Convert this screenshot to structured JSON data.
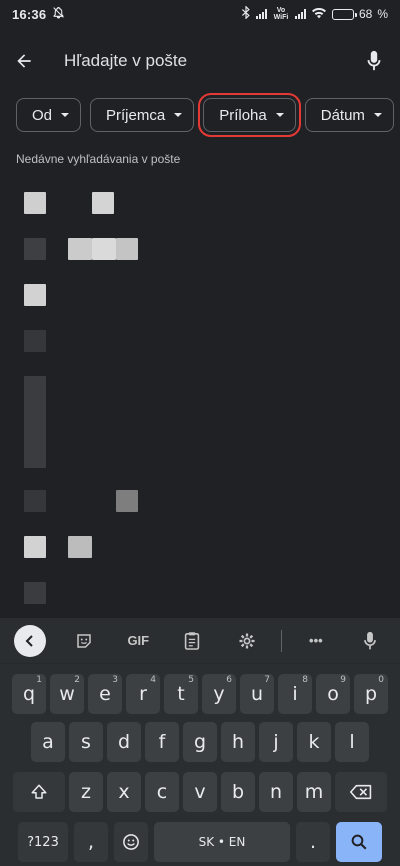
{
  "status": {
    "time": "16:36",
    "battery": "68",
    "battery_level": 0.68,
    "vowifi": "Vo WiFi",
    "icons": [
      "mute-notifications-icon",
      "bluetooth-icon",
      "signal-icon",
      "wifi-icon",
      "battery-icon"
    ]
  },
  "search": {
    "placeholder": "Hľadajte v pošte",
    "back_icon": "arrow-back-icon",
    "mic_icon": "mic-icon"
  },
  "chips": [
    "Od",
    "Príjemca",
    "Príloha",
    "Dátum"
  ],
  "recent": {
    "label": "Nedávne vyhľadávania v pošte"
  },
  "keyboard": {
    "toolbar": [
      "back-icon",
      "sticker-icon",
      "GIF",
      "clipboard-icon",
      "settings-icon",
      "more-icon",
      "mic-icon"
    ],
    "gif": "GIF",
    "more": "•••",
    "row1": [
      {
        "k": "q",
        "n": "1"
      },
      {
        "k": "w",
        "n": "2"
      },
      {
        "k": "e",
        "n": "3"
      },
      {
        "k": "r",
        "n": "4"
      },
      {
        "k": "t",
        "n": "5"
      },
      {
        "k": "y",
        "n": "6"
      },
      {
        "k": "u",
        "n": "7"
      },
      {
        "k": "i",
        "n": "8"
      },
      {
        "k": "o",
        "n": "9"
      },
      {
        "k": "p",
        "n": "0"
      }
    ],
    "row2": [
      "a",
      "s",
      "d",
      "f",
      "g",
      "h",
      "j",
      "k",
      "l"
    ],
    "row3": [
      "z",
      "x",
      "c",
      "v",
      "b",
      "n",
      "m"
    ],
    "symbols": "?123",
    "space": "SK • EN",
    "comma": ",",
    "period": "."
  },
  "colors": {
    "background": "#202124",
    "chip_border": "#5f6368",
    "highlight": "#e53935",
    "keyboard": "#2b2e31",
    "key": "#3c4043",
    "enter": "#8ab4f8"
  }
}
